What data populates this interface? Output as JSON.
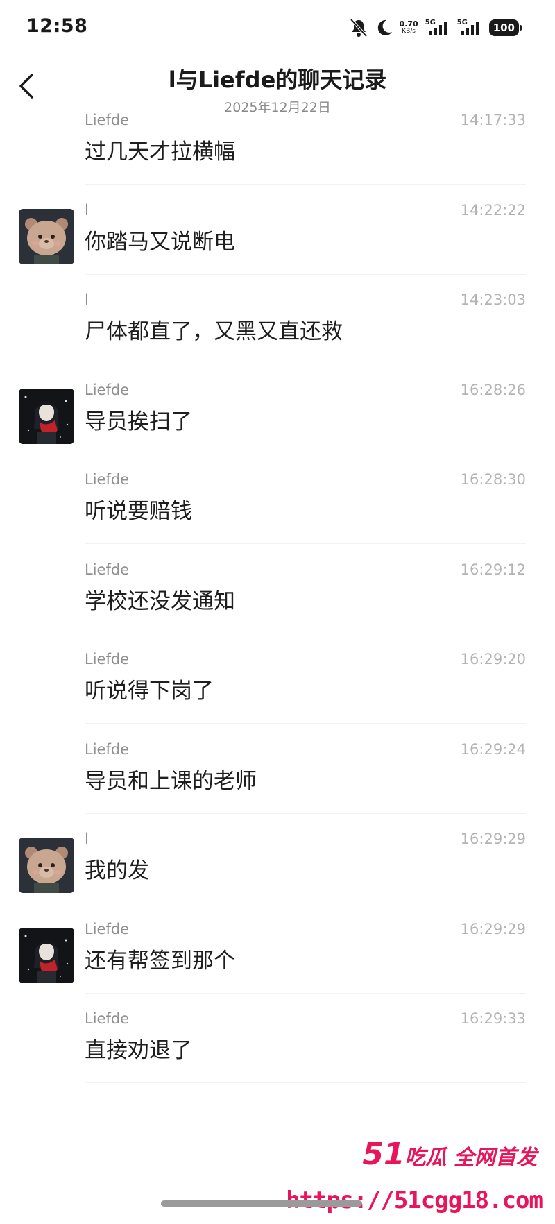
{
  "status_bar": {
    "time": "12:58",
    "net_speed_value": "0.70",
    "net_speed_unit": "KB/s",
    "sim1_label": "5G",
    "sim2_label": "5G",
    "battery": "100",
    "icons": [
      "bell-off-icon",
      "moon-icon",
      "signal-icon",
      "signal-icon",
      "battery-icon"
    ]
  },
  "header": {
    "back_icon": "chevron-left-icon",
    "title": "l与Liefde的聊天记录",
    "date": "2025年12月22日"
  },
  "messages": [
    {
      "sender": "Liefde",
      "time": "14:17:33",
      "text": "过几天才拉横幅",
      "avatar": ""
    },
    {
      "sender": "l",
      "time": "14:22:22",
      "text": "你踏马又说断电",
      "avatar": "bear"
    },
    {
      "sender": "l",
      "time": "14:23:03",
      "text": "尸体都直了，又黑又直还救",
      "avatar": ""
    },
    {
      "sender": "Liefde",
      "time": "16:28:26",
      "text": "导员挨扫了",
      "avatar": "girl"
    },
    {
      "sender": "Liefde",
      "time": "16:28:30",
      "text": "听说要赔钱",
      "avatar": ""
    },
    {
      "sender": "Liefde",
      "time": "16:29:12",
      "text": "学校还没发通知",
      "avatar": ""
    },
    {
      "sender": "Liefde",
      "time": "16:29:20",
      "text": "听说得下岗了",
      "avatar": ""
    },
    {
      "sender": "Liefde",
      "time": "16:29:24",
      "text": "导员和上课的老师",
      "avatar": ""
    },
    {
      "sender": "l",
      "time": "16:29:29",
      "text": "我的发",
      "avatar": "bear"
    },
    {
      "sender": "Liefde",
      "time": "16:29:29",
      "text": "还有帮签到那个",
      "avatar": "girl"
    },
    {
      "sender": "Liefde",
      "time": "16:29:33",
      "text": "直接劝退了",
      "avatar": ""
    }
  ],
  "watermark": {
    "brand_num": "51",
    "brand_text": "吃瓜 全网首发",
    "url": "https://51cgg18.com"
  }
}
